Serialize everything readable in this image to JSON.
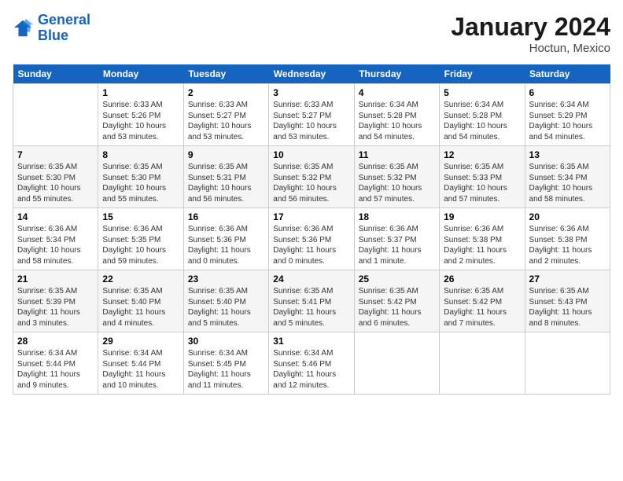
{
  "header": {
    "logo_line1": "General",
    "logo_line2": "Blue",
    "main_title": "January 2024",
    "subtitle": "Hoctun, Mexico"
  },
  "calendar": {
    "days_of_week": [
      "Sunday",
      "Monday",
      "Tuesday",
      "Wednesday",
      "Thursday",
      "Friday",
      "Saturday"
    ],
    "weeks": [
      [
        {
          "day": "",
          "content": ""
        },
        {
          "day": "1",
          "content": "Sunrise: 6:33 AM\nSunset: 5:26 PM\nDaylight: 10 hours\nand 53 minutes."
        },
        {
          "day": "2",
          "content": "Sunrise: 6:33 AM\nSunset: 5:27 PM\nDaylight: 10 hours\nand 53 minutes."
        },
        {
          "day": "3",
          "content": "Sunrise: 6:33 AM\nSunset: 5:27 PM\nDaylight: 10 hours\nand 53 minutes."
        },
        {
          "day": "4",
          "content": "Sunrise: 6:34 AM\nSunset: 5:28 PM\nDaylight: 10 hours\nand 54 minutes."
        },
        {
          "day": "5",
          "content": "Sunrise: 6:34 AM\nSunset: 5:28 PM\nDaylight: 10 hours\nand 54 minutes."
        },
        {
          "day": "6",
          "content": "Sunrise: 6:34 AM\nSunset: 5:29 PM\nDaylight: 10 hours\nand 54 minutes."
        }
      ],
      [
        {
          "day": "7",
          "content": "Sunrise: 6:35 AM\nSunset: 5:30 PM\nDaylight: 10 hours\nand 55 minutes."
        },
        {
          "day": "8",
          "content": "Sunrise: 6:35 AM\nSunset: 5:30 PM\nDaylight: 10 hours\nand 55 minutes."
        },
        {
          "day": "9",
          "content": "Sunrise: 6:35 AM\nSunset: 5:31 PM\nDaylight: 10 hours\nand 56 minutes."
        },
        {
          "day": "10",
          "content": "Sunrise: 6:35 AM\nSunset: 5:32 PM\nDaylight: 10 hours\nand 56 minutes."
        },
        {
          "day": "11",
          "content": "Sunrise: 6:35 AM\nSunset: 5:32 PM\nDaylight: 10 hours\nand 57 minutes."
        },
        {
          "day": "12",
          "content": "Sunrise: 6:35 AM\nSunset: 5:33 PM\nDaylight: 10 hours\nand 57 minutes."
        },
        {
          "day": "13",
          "content": "Sunrise: 6:35 AM\nSunset: 5:34 PM\nDaylight: 10 hours\nand 58 minutes."
        }
      ],
      [
        {
          "day": "14",
          "content": "Sunrise: 6:36 AM\nSunset: 5:34 PM\nDaylight: 10 hours\nand 58 minutes."
        },
        {
          "day": "15",
          "content": "Sunrise: 6:36 AM\nSunset: 5:35 PM\nDaylight: 10 hours\nand 59 minutes."
        },
        {
          "day": "16",
          "content": "Sunrise: 6:36 AM\nSunset: 5:36 PM\nDaylight: 11 hours\nand 0 minutes."
        },
        {
          "day": "17",
          "content": "Sunrise: 6:36 AM\nSunset: 5:36 PM\nDaylight: 11 hours\nand 0 minutes."
        },
        {
          "day": "18",
          "content": "Sunrise: 6:36 AM\nSunset: 5:37 PM\nDaylight: 11 hours\nand 1 minute."
        },
        {
          "day": "19",
          "content": "Sunrise: 6:36 AM\nSunset: 5:38 PM\nDaylight: 11 hours\nand 2 minutes."
        },
        {
          "day": "20",
          "content": "Sunrise: 6:36 AM\nSunset: 5:38 PM\nDaylight: 11 hours\nand 2 minutes."
        }
      ],
      [
        {
          "day": "21",
          "content": "Sunrise: 6:35 AM\nSunset: 5:39 PM\nDaylight: 11 hours\nand 3 minutes."
        },
        {
          "day": "22",
          "content": "Sunrise: 6:35 AM\nSunset: 5:40 PM\nDaylight: 11 hours\nand 4 minutes."
        },
        {
          "day": "23",
          "content": "Sunrise: 6:35 AM\nSunset: 5:40 PM\nDaylight: 11 hours\nand 5 minutes."
        },
        {
          "day": "24",
          "content": "Sunrise: 6:35 AM\nSunset: 5:41 PM\nDaylight: 11 hours\nand 5 minutes."
        },
        {
          "day": "25",
          "content": "Sunrise: 6:35 AM\nSunset: 5:42 PM\nDaylight: 11 hours\nand 6 minutes."
        },
        {
          "day": "26",
          "content": "Sunrise: 6:35 AM\nSunset: 5:42 PM\nDaylight: 11 hours\nand 7 minutes."
        },
        {
          "day": "27",
          "content": "Sunrise: 6:35 AM\nSunset: 5:43 PM\nDaylight: 11 hours\nand 8 minutes."
        }
      ],
      [
        {
          "day": "28",
          "content": "Sunrise: 6:34 AM\nSunset: 5:44 PM\nDaylight: 11 hours\nand 9 minutes."
        },
        {
          "day": "29",
          "content": "Sunrise: 6:34 AM\nSunset: 5:44 PM\nDaylight: 11 hours\nand 10 minutes."
        },
        {
          "day": "30",
          "content": "Sunrise: 6:34 AM\nSunset: 5:45 PM\nDaylight: 11 hours\nand 11 minutes."
        },
        {
          "day": "31",
          "content": "Sunrise: 6:34 AM\nSunset: 5:46 PM\nDaylight: 11 hours\nand 12 minutes."
        },
        {
          "day": "",
          "content": ""
        },
        {
          "day": "",
          "content": ""
        },
        {
          "day": "",
          "content": ""
        }
      ]
    ]
  }
}
